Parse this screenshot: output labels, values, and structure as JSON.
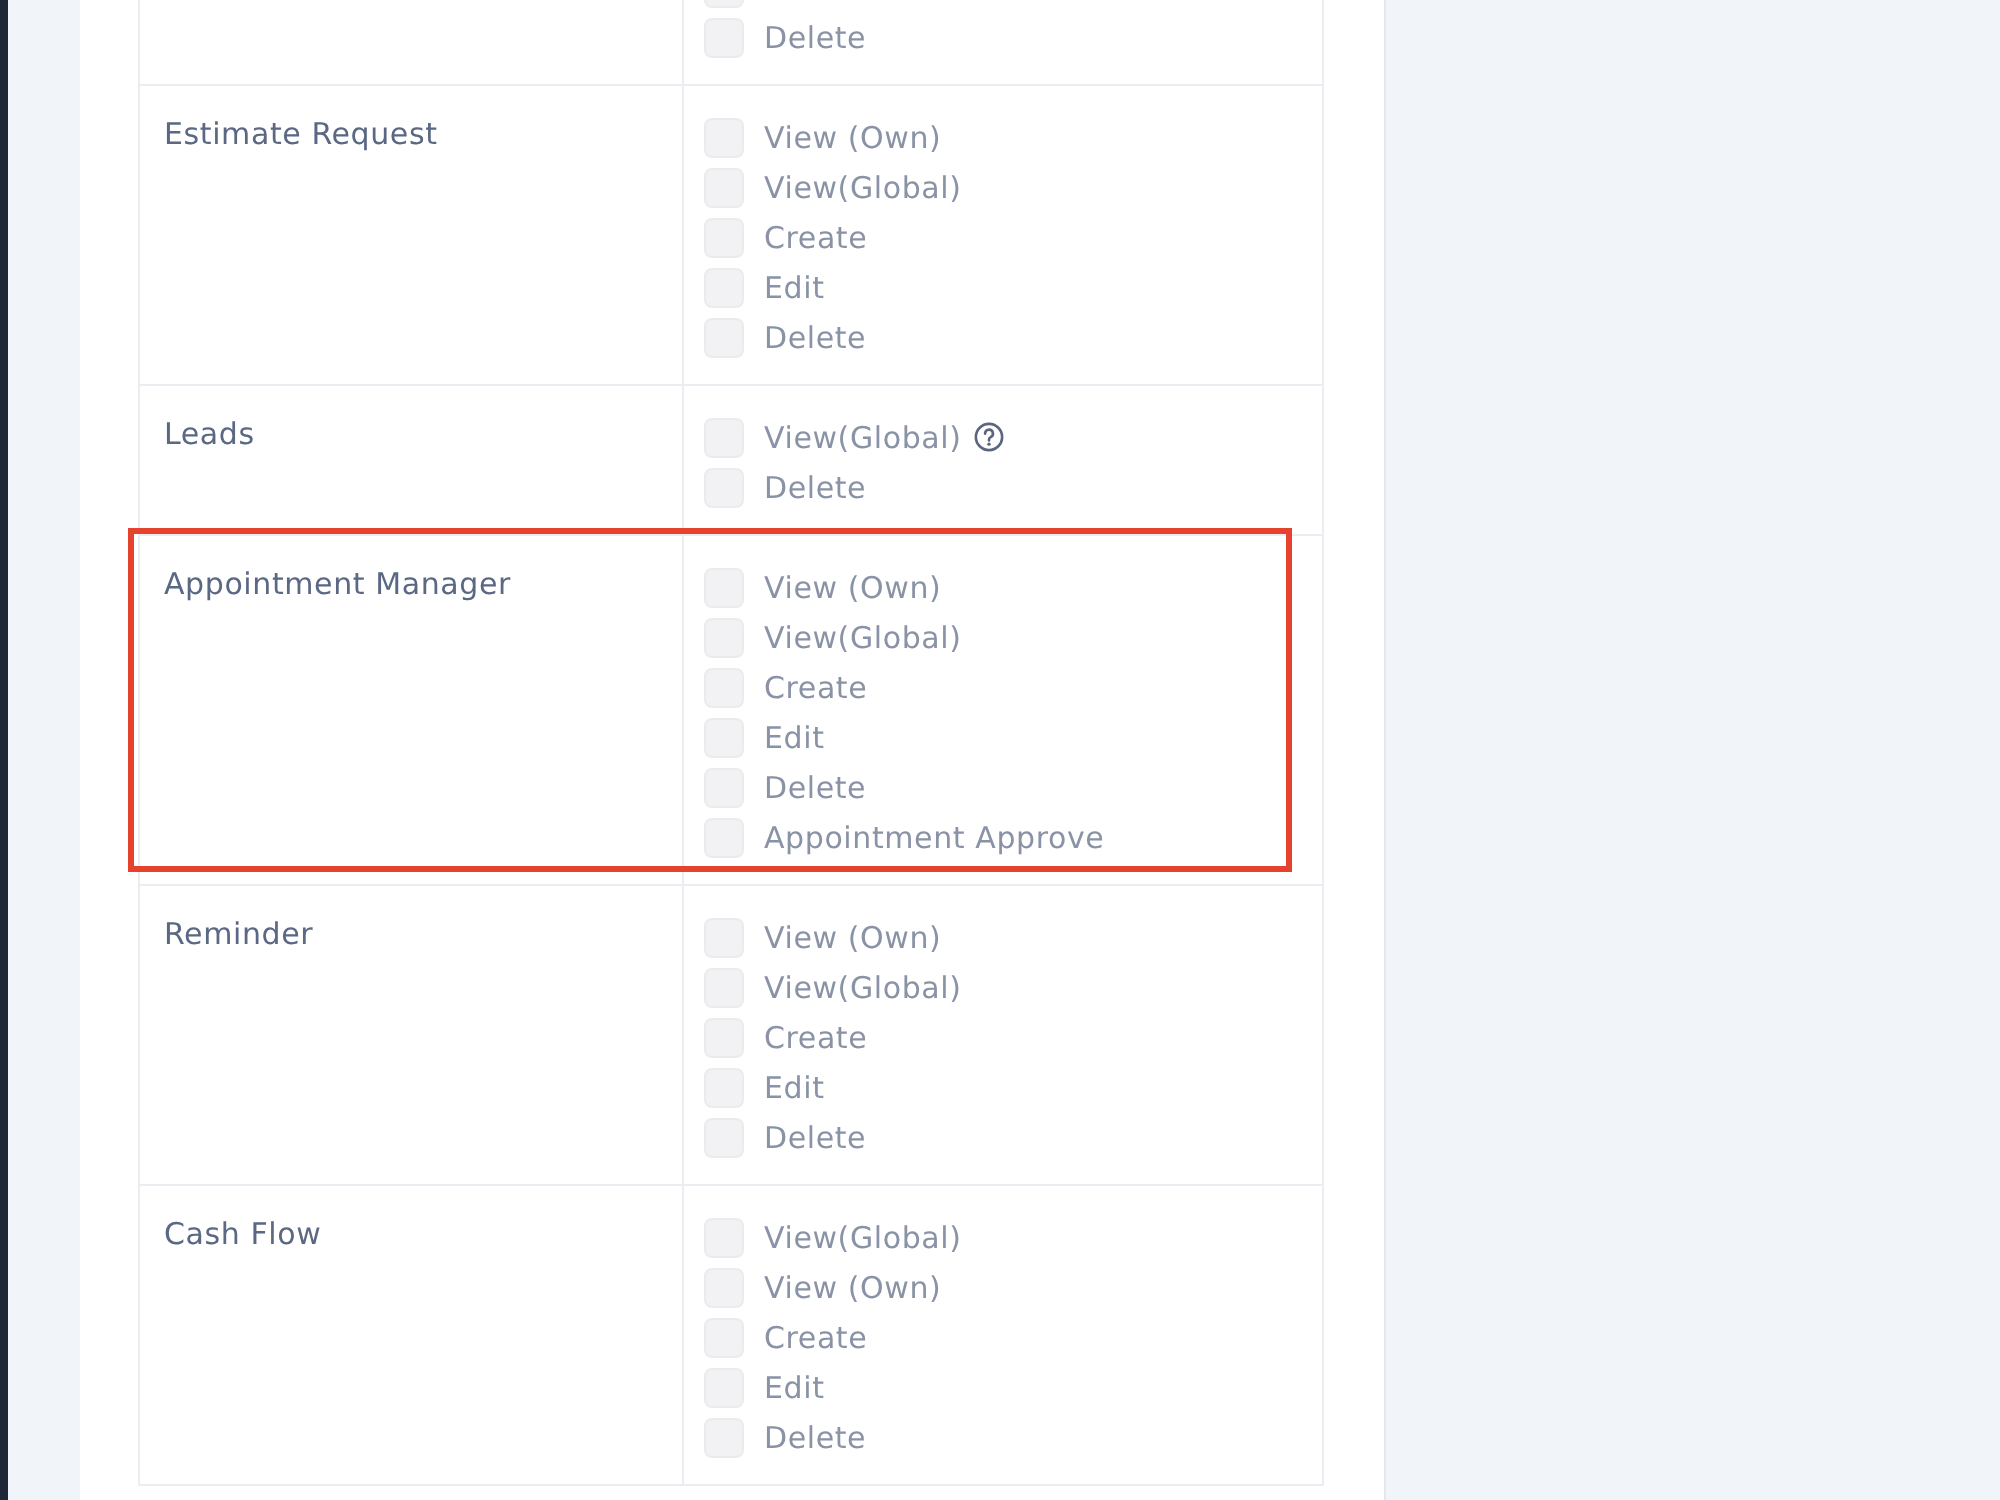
{
  "permissions": {
    "rows": [
      {
        "highlighted": false,
        "options": [
          {
            "checked": false,
            "help": false
          },
          {
            "label": "Delete",
            "checked": false,
            "help": false
          }
        ]
      },
      {
        "feature": "Estimate Request",
        "highlighted": false,
        "options": [
          {
            "label": "View (Own)",
            "checked": false,
            "help": false
          },
          {
            "label": "View(Global)",
            "checked": false,
            "help": false
          },
          {
            "label": "Create",
            "checked": false,
            "help": false
          },
          {
            "label": "Edit",
            "checked": false,
            "help": false
          },
          {
            "label": "Delete",
            "checked": false,
            "help": false
          }
        ]
      },
      {
        "feature": "Leads",
        "highlighted": false,
        "options": [
          {
            "label": "View(Global)",
            "checked": false,
            "help": true
          },
          {
            "label": "Delete",
            "checked": false,
            "help": false
          }
        ]
      },
      {
        "feature": "Appointment Manager",
        "highlighted": true,
        "options": [
          {
            "label": "View (Own)",
            "checked": false,
            "help": false
          },
          {
            "label": "View(Global)",
            "checked": false,
            "help": false
          },
          {
            "label": "Create",
            "checked": false,
            "help": false
          },
          {
            "label": "Edit",
            "checked": false,
            "help": false
          },
          {
            "label": "Delete",
            "checked": false,
            "help": false
          },
          {
            "label": "Appointment Approve",
            "checked": false,
            "help": false
          }
        ]
      },
      {
        "feature": "Reminder",
        "highlighted": false,
        "options": [
          {
            "label": "View (Own)",
            "checked": false,
            "help": false
          },
          {
            "label": "View(Global)",
            "checked": false,
            "help": false
          },
          {
            "label": "Create",
            "checked": false,
            "help": false
          },
          {
            "label": "Edit",
            "checked": false,
            "help": false
          },
          {
            "label": "Delete",
            "checked": false,
            "help": false
          }
        ]
      },
      {
        "feature": "Cash Flow",
        "highlighted": false,
        "options": [
          {
            "label": "View(Global)",
            "checked": false,
            "help": false
          },
          {
            "label": "View (Own)",
            "checked": false,
            "help": false
          },
          {
            "label": "Create",
            "checked": false,
            "help": false
          },
          {
            "label": "Edit",
            "checked": false,
            "help": false
          },
          {
            "label": "Delete",
            "checked": false,
            "help": false
          }
        ]
      }
    ]
  }
}
